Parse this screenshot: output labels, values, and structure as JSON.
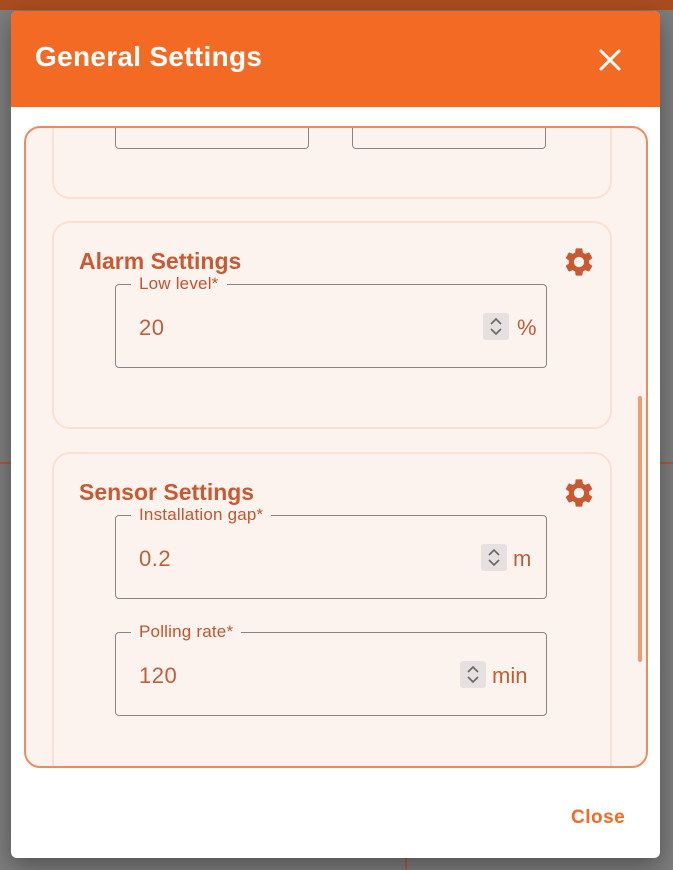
{
  "dialog": {
    "title": "General Settings",
    "close_label": "Close"
  },
  "sections": {
    "alarm": {
      "title": "Alarm Settings",
      "fields": {
        "low_level": {
          "label": "Low level*",
          "value": "20",
          "unit": "%"
        }
      }
    },
    "sensor": {
      "title": "Sensor Settings",
      "fields": {
        "installation_gap": {
          "label": "Installation gap*",
          "value": "0.2",
          "unit": "m"
        },
        "polling_rate": {
          "label": "Polling rate*",
          "value": "120",
          "unit": "min"
        }
      }
    }
  },
  "colors": {
    "accent": "#f26a24",
    "section_title": "#c75a33",
    "panel_bg": "#fdf3ee"
  },
  "icons": {
    "close": "close-icon",
    "section_settings": "gear-icon",
    "spinner": "spinner-arrows-icon"
  }
}
